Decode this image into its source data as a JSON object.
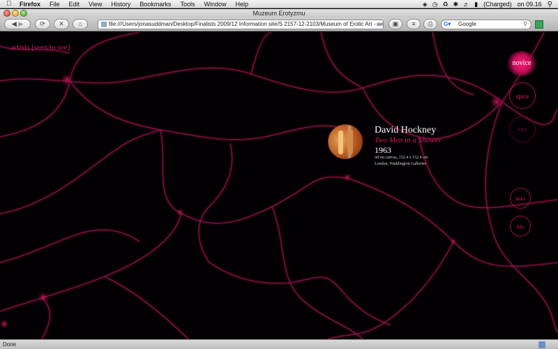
{
  "menubar": {
    "app": "Firefox",
    "items": [
      "File",
      "Edit",
      "View",
      "History",
      "Bookmarks",
      "Tools",
      "Window",
      "Help"
    ],
    "battery": "(Charged)",
    "clock": "on 09.16"
  },
  "window": {
    "title": "Muzeum Erotyzmu"
  },
  "toolbar": {
    "url": "file:///Users/jonasuddman/Desktop/Finalists 2009/12 Information site/S 2157-12-2103/Museum of Erotic Art - we",
    "search_placeholder": "Google"
  },
  "page": {
    "nav_artists": "artists",
    "nav_sub": "[seen/to see]",
    "artwork": {
      "artist": "David Hockney",
      "title": "Two Men in a Shower",
      "year": "1963",
      "medium": "oil on canvas, 152.4 x 152.4 cm",
      "location": "London, Waddington Galleries"
    },
    "levels": {
      "novice": "novice",
      "spice": "spice",
      "vice": "vice"
    },
    "links": "links",
    "info": "info"
  },
  "statusbar": {
    "text": "Done"
  },
  "colors": {
    "accent": "#d21c63",
    "background": "#030003",
    "vein": "#8a1444"
  },
  "icons": [
    "apple-icon",
    "back-icon",
    "forward-icon",
    "reload-icon",
    "stop-icon",
    "home-icon",
    "bookmark-star-icon",
    "search-icon"
  ]
}
